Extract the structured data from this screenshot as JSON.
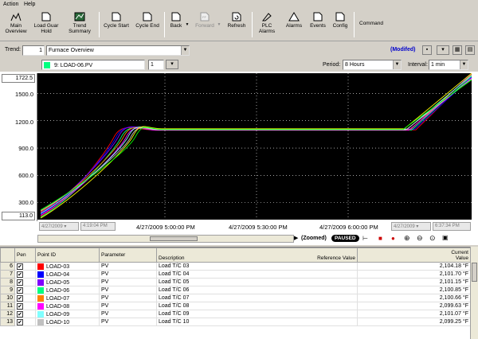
{
  "menu": {
    "action": "Action",
    "help": "Help"
  },
  "toolbar": {
    "main_overview": "Main\nOverview",
    "load_guar_hold": "Load Guar\nHold",
    "trend_summary": "Trend\nSummary",
    "cycle_start": "Cycle Start",
    "cycle_end": "Cycle End",
    "back": "Back",
    "forward": "Forward",
    "refresh": "Refresh",
    "plc_alarms": "PLC\nAlarms",
    "alarms": "Alarms",
    "events": "Events",
    "config": "Config",
    "command": "Command"
  },
  "trend": {
    "label": "Trend:",
    "number": "1",
    "name": "Furnace Overview",
    "modified": "(Modifed)",
    "pen_selector": "9: LOAD-06.PV",
    "pen_count": "1",
    "period_label": "Period:",
    "period": "8 Hours",
    "interval_label": "Interval:",
    "interval": "1 min"
  },
  "chart": {
    "y_max_field": "1722.5",
    "y_min_field": "113.0",
    "y_ticks": [
      "1500.0",
      "1200.0",
      "900.0",
      "600.0",
      "300.0"
    ],
    "x_ticks": [
      "4/27/2009 5:00:00 PM",
      "4/27/2009 5:30:00 PM",
      "4/27/2009 6:00:00 PM"
    ],
    "start_date": "4/27/2009",
    "start_time": "4:19:04 PM",
    "end_date": "4/27/2009",
    "end_time": "6:37:34 PM",
    "status_zoomed": "(Zoomed)",
    "status_paused": "PAUSED"
  },
  "chart_data": {
    "type": "line",
    "x_range": [
      "4/27/2009 4:19:04 PM",
      "4/27/2009 6:37:34 PM"
    ],
    "ylim": [
      113.0,
      1722.5
    ],
    "grid": true,
    "series": [
      {
        "color": "#ff0000",
        "start": 150,
        "plateau": 1100,
        "ramp_end": 1700
      },
      {
        "color": "#0000ff",
        "start": 170,
        "plateau": 1105,
        "ramp_end": 1680
      },
      {
        "color": "#8000ff",
        "start": 190,
        "plateau": 1110,
        "ramp_end": 1720
      },
      {
        "color": "#00ff80",
        "start": 140,
        "plateau": 1098,
        "ramp_end": 1690
      },
      {
        "color": "#ff8000",
        "start": 200,
        "plateau": 1102,
        "ramp_end": 1710
      },
      {
        "color": "#ff00ff",
        "start": 160,
        "plateau": 1095,
        "ramp_end": 1670
      },
      {
        "color": "#80ffff",
        "start": 180,
        "plateau": 1108,
        "ramp_end": 1700
      },
      {
        "color": "#c0c0c0",
        "start": 210,
        "plateau": 1099,
        "ramp_end": 1660
      },
      {
        "color": "#ffff00",
        "start": 130,
        "plateau": 1112,
        "ramp_end": 1722
      },
      {
        "color": "#00ff00",
        "start": 220,
        "plateau": 1104,
        "ramp_end": 1650
      }
    ]
  },
  "grid": {
    "headers": {
      "pen": "Pen",
      "point_id": "Point ID",
      "parameter": "Parameter",
      "description": "Description",
      "reference_value": "Reference Value",
      "current_value": "Current\nValue"
    },
    "rows": [
      {
        "num": "6",
        "color": "#ff0000",
        "point_id": "LOAD-03",
        "parameter": "PV",
        "description": "Load T/C 03",
        "current_value": "2,104.18 °F"
      },
      {
        "num": "7",
        "color": "#0000ff",
        "point_id": "LOAD-04",
        "parameter": "PV",
        "description": "Load T/C 04",
        "current_value": "2,101.70 °F"
      },
      {
        "num": "8",
        "color": "#8000ff",
        "point_id": "LOAD-05",
        "parameter": "PV",
        "description": "Load T/C 05",
        "current_value": "2,101.15 °F"
      },
      {
        "num": "9",
        "color": "#00ff80",
        "point_id": "LOAD-06",
        "parameter": "PV",
        "description": "Load T/C 06",
        "current_value": "2,100.85 °F"
      },
      {
        "num": "10",
        "color": "#ff8000",
        "point_id": "LOAD-07",
        "parameter": "PV",
        "description": "Load T/C 07",
        "current_value": "2,100.66 °F"
      },
      {
        "num": "11",
        "color": "#ff00ff",
        "point_id": "LOAD-08",
        "parameter": "PV",
        "description": "Load T/C 08",
        "current_value": "2,099.63 °F"
      },
      {
        "num": "12",
        "color": "#80ffff",
        "point_id": "LOAD-09",
        "parameter": "PV",
        "description": "Load T/C 09",
        "current_value": "2,101.07 °F"
      },
      {
        "num": "13",
        "color": "#c0c0c0",
        "point_id": "LOAD-10",
        "parameter": "PV",
        "description": "Load T/C 10",
        "current_value": "2,099.25 °F"
      }
    ]
  }
}
